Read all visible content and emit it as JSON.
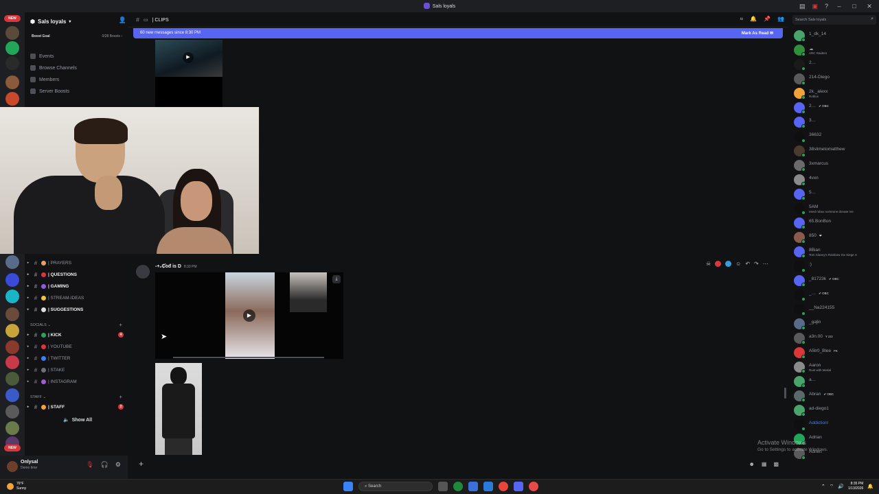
{
  "window": {
    "title": "Sals loyals"
  },
  "rail": {
    "badges": [
      "NEW",
      "NEW"
    ]
  },
  "sidebar": {
    "server_name": "Sals loyals",
    "boost_goal_label": "Boost Goal",
    "boost_count": "0/28 Boosts",
    "nav": [
      {
        "label": "Events",
        "icon": "calendar-icon"
      },
      {
        "label": "Browse Channels",
        "icon": "browse-icon"
      },
      {
        "label": "Members",
        "icon": "members-icon"
      },
      {
        "label": "Server Boosts",
        "icon": "boost-icon"
      }
    ],
    "channels_top": [
      {
        "label": "| PRAYERS",
        "color": "#e0a16a",
        "bold": false
      },
      {
        "label": "| QUESTIONS",
        "color": "#da373c",
        "bold": true
      },
      {
        "label": "| GAMING",
        "color": "#8e5cd9",
        "bold": true
      },
      {
        "label": "| STREAM-IDEAS",
        "color": "#f0c23b",
        "bold": false
      },
      {
        "label": "| SUGGESTIONS",
        "color": "#dbdee1",
        "bold": true
      }
    ],
    "category_socials": "SOCIALS",
    "channels_socials": [
      {
        "label": "| KICK",
        "color": "#23a55a",
        "bold": true,
        "count": "4"
      },
      {
        "label": "| YOUTUBE",
        "color": "#da373c",
        "bold": false
      },
      {
        "label": "| TWITTER",
        "color": "#3b82f6",
        "bold": false
      },
      {
        "label": "| STAKE",
        "color": "#6d6f78",
        "bold": false
      },
      {
        "label": "| INSTAGRAM",
        "color": "#a55ad9",
        "bold": false
      }
    ],
    "category_staff": "STAFF",
    "channels_staff": [
      {
        "label": "| STAFF",
        "color": "#f0a23b",
        "bold": true,
        "count": "2"
      }
    ],
    "show_all": "Show All"
  },
  "channel": {
    "name": "| CLIPS",
    "new_messages": "60 new messages since 8:30 PM",
    "mark_as_read": "Mark As Read"
  },
  "message": {
    "author": "-+₂₵̂ođ is D",
    "time": "8:33 PM"
  },
  "members": {
    "search_placeholder": "Search Sals loyals",
    "list": [
      {
        "name": "1_dk_14",
        "sub": "",
        "tag": "",
        "color": "#4aa36b"
      },
      {
        "name": "☁",
        "sub": "ARC Raiders",
        "tag": "",
        "color": "#2f8f3a"
      },
      {
        "name": "2…",
        "sub": "",
        "tag": "",
        "color": "#1a1a1a"
      },
      {
        "name": "214-Diego",
        "sub": "",
        "tag": "",
        "color": "#5a5a5a"
      },
      {
        "name": "2k._alexx",
        "sub": "Roblox",
        "tag": "",
        "color": "#f0a23b"
      },
      {
        "name": "2…",
        "sub": "",
        "tag": "✔ OBC",
        "color": "#5865f2"
      },
      {
        "name": "3…",
        "sub": "",
        "tag": "",
        "color": "#5865f2"
      },
      {
        "name": "36632",
        "sub": "",
        "tag": "",
        "color": "#0f0f0f"
      },
      {
        "name": "38slimetomatthew",
        "sub": "",
        "tag": "",
        "color": "#4a3a30"
      },
      {
        "name": "3xmarcus",
        "sub": "",
        "tag": "",
        "color": "#6a6a6a"
      },
      {
        "name": "4vxn",
        "sub": "",
        "tag": "",
        "color": "#8a8a8a"
      },
      {
        "name": "5…",
        "sub": "",
        "tag": "",
        "color": "#5865f2"
      },
      {
        "name": "5AM",
        "sub": "need robux someone donate me",
        "tag": "",
        "color": "#0f0f0f"
      },
      {
        "name": "65.BonBon",
        "sub": "",
        "tag": "",
        "color": "#5865f2"
      },
      {
        "name": "850",
        "sub": "",
        "tag": "❤",
        "color": "#8a5a4a"
      },
      {
        "name": "8Bian",
        "sub": "Tom Clancy's Rainbow Six Siege X",
        "tag": "",
        "color": "#5865f2"
      },
      {
        "name": ":)",
        "sub": "",
        "tag": "",
        "color": "#0f0f0f"
      },
      {
        "name": "_81723k",
        "sub": "",
        "tag": "✔ OBC",
        "color": "#5865f2"
      },
      {
        "name": "_…",
        "sub": "",
        "tag": "✔ OBC",
        "color": "#0f0f0f"
      },
      {
        "name": "__Na224155",
        "sub": "",
        "tag": "",
        "color": "#0f0f0f"
      },
      {
        "name": "_gəʃɨn",
        "sub": "",
        "tag": "",
        "color": "#5a6a8a"
      },
      {
        "name": "a3n.00",
        "sub": "",
        "tag": "Y zzz",
        "color": "#5a5a5a"
      },
      {
        "name": "A5tr0_Blee",
        "sub": "",
        "tag": "FK",
        "color": "#da373c"
      },
      {
        "name": "Aaron",
        "sub": "Rust with Medal",
        "tag": "",
        "color": "#8a8a8a"
      },
      {
        "name": "a…",
        "sub": "",
        "tag": "",
        "color": "#4aa36b"
      },
      {
        "name": "Abran",
        "sub": "",
        "tag": "✔ OBC",
        "color": "#5a6a6a"
      },
      {
        "name": "ad-diego1",
        "sub": "",
        "tag": "",
        "color": "#4aa36b"
      },
      {
        "name": "Addiction!",
        "sub": "",
        "tag": "",
        "color": "#0f0f0f",
        "highlight": "#3b82f6"
      },
      {
        "name": "Adrian",
        "sub": "",
        "tag": "",
        "color": "#23a55a"
      },
      {
        "name": "Adrien",
        "sub": "",
        "tag": "",
        "color": "#5a5a5a"
      }
    ]
  },
  "watermark": {
    "title": "Activate Windows",
    "subtitle": "Go to Settings to activate Windows."
  },
  "user_panel": {
    "name": "Onlysal",
    "status": "Demo time"
  },
  "taskbar": {
    "temperature": "76°F",
    "condition": "Sunny",
    "search": "Search",
    "time": "8:35 PM",
    "date": "1/13/2026"
  }
}
